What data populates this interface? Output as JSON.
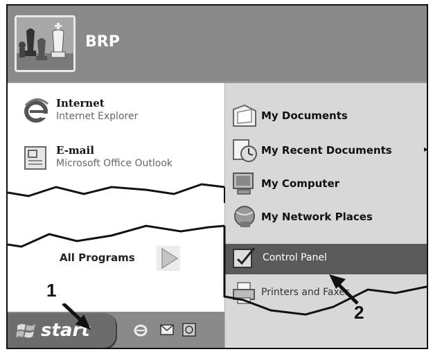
{
  "user": {
    "name": "BRP"
  },
  "pinned": [
    {
      "title": "Internet",
      "subtitle": "Internet Explorer",
      "icon": "internet-explorer-icon"
    },
    {
      "title": "E-mail",
      "subtitle": "Microsoft Office Outlook",
      "icon": "outlook-icon"
    }
  ],
  "all_programs": {
    "label": "All Programs",
    "icon": "green-arrow-right-icon"
  },
  "places": [
    {
      "label": "My Documents",
      "icon": "my-documents-icon"
    },
    {
      "label": "My Recent Documents",
      "icon": "recent-documents-icon",
      "submenu": "▸"
    },
    {
      "label": "My Computer",
      "icon": "my-computer-icon"
    },
    {
      "label": "My Network Places",
      "icon": "network-places-icon"
    },
    {
      "label": "Control Panel",
      "icon": "control-panel-icon",
      "selected": true
    },
    {
      "label": "Printers and Faxes",
      "icon": "printer-icon"
    }
  ],
  "taskbar": {
    "start_label": "start",
    "quick_launch": [
      "internet-explorer-icon",
      "outlook-express-icon",
      "show-desktop-icon"
    ]
  },
  "callouts": {
    "one": "1",
    "two": "2"
  },
  "colors": {
    "header": "#8a8a8a",
    "right_pane": "#d8d8d8",
    "selected": "#5a5a5a"
  }
}
